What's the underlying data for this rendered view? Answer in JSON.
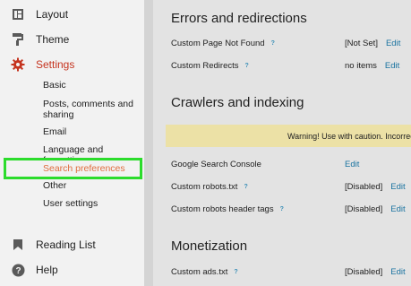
{
  "sidebar": {
    "layout_label": "Layout",
    "theme_label": "Theme",
    "settings_label": "Settings",
    "sub_items": {
      "basic": "Basic",
      "posts_1": "Posts, comments and",
      "posts_2": "sharing",
      "email": "Email",
      "language": "Language and formatting",
      "search": "Search preferences",
      "other": "Other",
      "user": "User settings"
    },
    "reading_list_label": "Reading List",
    "help_label": "Help"
  },
  "sections": {
    "errors": {
      "title": "Errors and redirections",
      "custom_page_label": "Custom Page Not Found",
      "custom_page_value": "[Not Set]",
      "custom_redirects_label": "Custom Redirects",
      "custom_redirects_value": "no items"
    },
    "crawlers": {
      "title": "Crawlers and indexing",
      "warning": "Warning! Use with caution. Incorrect use",
      "console_label": "Google Search Console",
      "robots_label": "Custom robots.txt",
      "robots_value": "[Disabled]",
      "robots_header_label": "Custom robots header tags",
      "robots_header_value": "[Disabled]"
    },
    "monetization": {
      "title": "Monetization",
      "ads_label": "Custom ads.txt",
      "ads_value": "[Disabled]"
    }
  },
  "common": {
    "edit": "Edit",
    "help_mark": "?"
  },
  "colors": {
    "accent": "#c5341f",
    "highlight_border": "#2cdc2c",
    "link": "#1a73a0",
    "warning_bg": "#ece1a6"
  },
  "icons": [
    "layout-icon",
    "paint-roller-icon",
    "gear-icon",
    "bookmark-icon",
    "help-icon"
  ]
}
